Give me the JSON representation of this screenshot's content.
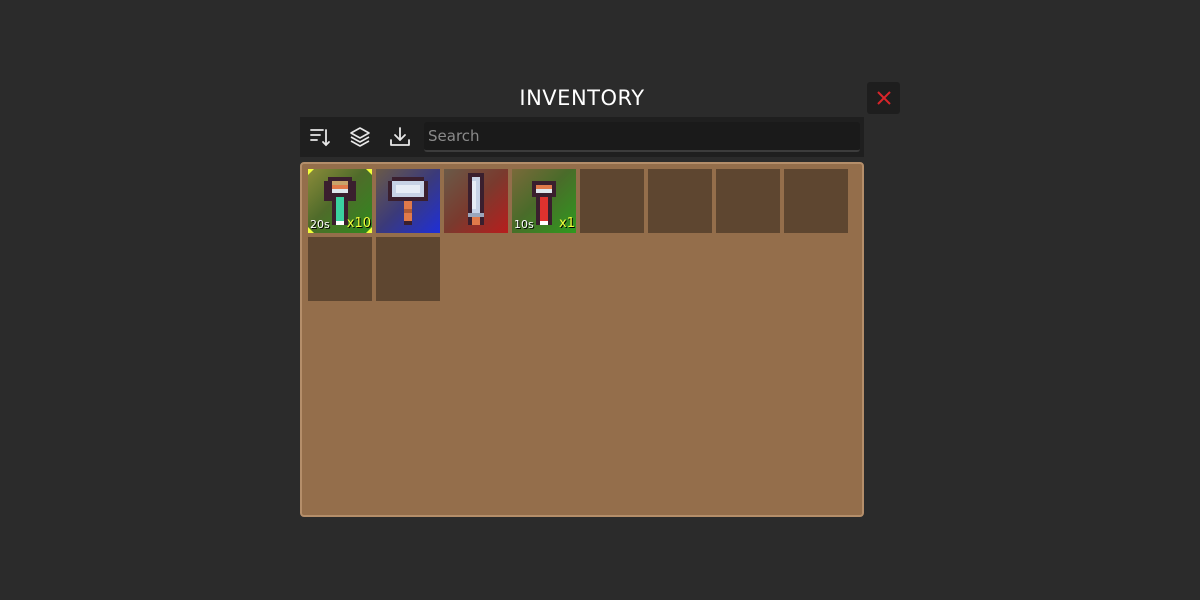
{
  "window": {
    "title": "INVENTORY"
  },
  "toolbar": {
    "sort_icon": "sort-descending-icon",
    "layers_icon": "layers-icon",
    "download_icon": "download-icon",
    "close_icon": "close-x-icon"
  },
  "search": {
    "placeholder": "Search",
    "value": ""
  },
  "colors": {
    "background": "#2b2b2b",
    "panel": "#946e4b",
    "slot_empty": "#5e4630",
    "close_x": "#d9252a",
    "count_text": "#f2ff3a"
  },
  "slots": [
    {
      "item": "green-potion",
      "rarity_color": "#2f8a1e",
      "time": "20s",
      "count": "x10",
      "selected": true
    },
    {
      "item": "battle-axe",
      "rarity_color": "#1f2fd8",
      "time": "",
      "count": "",
      "selected": false
    },
    {
      "item": "sword",
      "rarity_color": "#b81d1d",
      "time": "",
      "count": "",
      "selected": false
    },
    {
      "item": "red-potion",
      "rarity_color": "#2f9a1e",
      "time": "10s",
      "count": "x1",
      "selected": false
    },
    {
      "item": "",
      "time": "",
      "count": ""
    },
    {
      "item": "",
      "time": "",
      "count": ""
    },
    {
      "item": "",
      "time": "",
      "count": ""
    },
    {
      "item": "",
      "time": "",
      "count": ""
    },
    {
      "item": "",
      "time": "",
      "count": ""
    },
    {
      "item": "",
      "time": "",
      "count": ""
    }
  ]
}
